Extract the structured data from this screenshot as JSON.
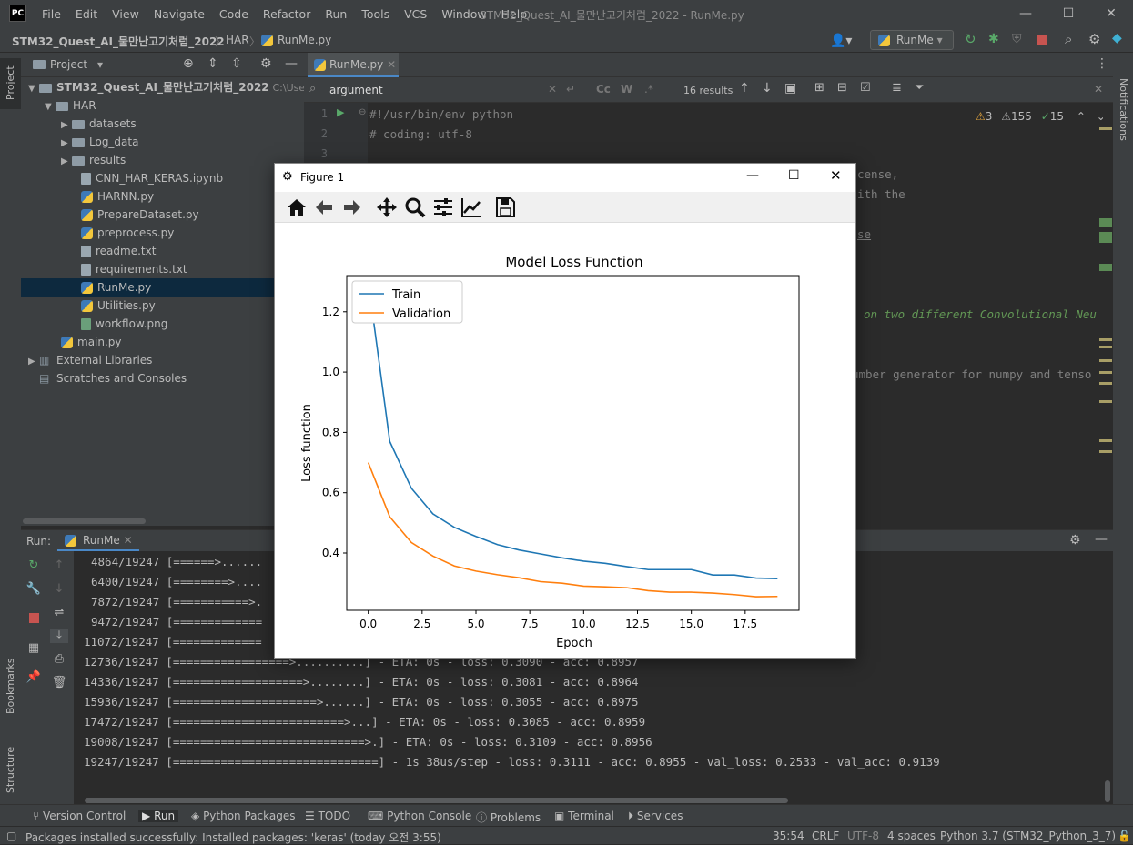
{
  "window": {
    "logo": "PC",
    "title": "STM32_Quest_AI_물만난고기처럼_2022 - RunMe.py",
    "menu": [
      "File",
      "Edit",
      "View",
      "Navigate",
      "Code",
      "Refactor",
      "Run",
      "Tools",
      "VCS",
      "Window",
      "Help"
    ],
    "controls": [
      "minimize-icon",
      "maximize-icon",
      "close-icon"
    ]
  },
  "breadcrumb": [
    "STM32_Quest_AI_물만난고기처럼_2022",
    "HAR",
    "RunMe.py"
  ],
  "run_config": "RunMe",
  "project": {
    "header": "Project",
    "root": "STM32_Quest_AI_물만난고기처럼_2022",
    "root_path": "C:\\User",
    "items": [
      {
        "label": "HAR",
        "kind": "folder",
        "level": 1,
        "expanded": true
      },
      {
        "label": "datasets",
        "kind": "folder",
        "level": 2
      },
      {
        "label": "Log_data",
        "kind": "folder",
        "level": 2
      },
      {
        "label": "results",
        "kind": "folder",
        "level": 2
      },
      {
        "label": "CNN_HAR_KERAS.ipynb",
        "kind": "file",
        "level": 2
      },
      {
        "label": "HARNN.py",
        "kind": "py",
        "level": 2
      },
      {
        "label": "PrepareDataset.py",
        "kind": "py",
        "level": 2
      },
      {
        "label": "preprocess.py",
        "kind": "py",
        "level": 2
      },
      {
        "label": "readme.txt",
        "kind": "file",
        "level": 2
      },
      {
        "label": "requirements.txt",
        "kind": "file",
        "level": 2
      },
      {
        "label": "RunMe.py",
        "kind": "py",
        "level": 2,
        "selected": true
      },
      {
        "label": "Utilities.py",
        "kind": "py",
        "level": 2
      },
      {
        "label": "workflow.png",
        "kind": "file",
        "level": 2
      },
      {
        "label": "main.py",
        "kind": "py",
        "level": 1
      },
      {
        "label": "External Libraries",
        "kind": "lib",
        "level": 0
      },
      {
        "label": "Scratches and Consoles",
        "kind": "scratch",
        "level": 0
      }
    ]
  },
  "side_tabs": {
    "left_top": "Project",
    "left_mid": "Bookmarks",
    "left_bottom": "Structure",
    "right": "Notifications"
  },
  "editor": {
    "tab": "RunMe.py",
    "search": {
      "value": "argument",
      "results": "16 results"
    },
    "inspections": {
      "warnings": "3",
      "weak": "155",
      "ok": "15"
    },
    "line_numbers": [
      "1",
      "2",
      "3"
    ],
    "lines": [
      "#!/usr/bin/env python",
      "# coding: utf-8",
      ""
    ],
    "fragments": [
      "cense,",
      "ith the",
      "se",
      "on two different Convolutional Neu",
      "umber generator for numpy and tenso"
    ]
  },
  "run": {
    "label": "Run:",
    "tab": "RunMe",
    "console": [
      "4864/19247 [======>......",
      "6400/19247 [========>....",
      "7872/19247 [===========>.",
      "9472/19247 [=============",
      "11072/19247 [=============",
      "12736/19247 [=================>..........] - ETA: 0s - loss: 0.3090 - acc: 0.8957",
      "14336/19247 [===================>........] - ETA: 0s - loss: 0.3081 - acc: 0.8964",
      "15936/19247 [=====================>......] - ETA: 0s - loss: 0.3055 - acc: 0.8975",
      "17472/19247 [=========================>...] - ETA: 0s - loss: 0.3085 - acc: 0.8959",
      "19008/19247 [============================>.] - ETA: 0s - loss: 0.3109 - acc: 0.8956",
      "19247/19247 [==============================] - 1s 38us/step - loss: 0.3111 - acc: 0.8955 - val_loss: 0.2533 - val_acc: 0.9139"
    ]
  },
  "bottom_tabs": [
    "Version Control",
    "Run",
    "Python Packages",
    "TODO",
    "Python Console",
    "Problems",
    "Terminal",
    "Services"
  ],
  "status": {
    "message": "Packages installed successfully: Installed packages: 'keras' (today 오전 3:55)",
    "position": "35:54",
    "line_sep": "CRLF",
    "encoding": "UTF-8",
    "indent": "4 spaces",
    "interpreter": "Python 3.7 (STM32_Python_3_7)"
  },
  "figure": {
    "window_title": "Figure 1",
    "toolbar": [
      "home-icon",
      "back-icon",
      "forward-icon",
      "pan-icon",
      "zoom-icon",
      "configure-subplots-icon",
      "edit-axis-icon",
      "save-icon"
    ]
  },
  "chart_data": {
    "type": "line",
    "title": "Model Loss Function",
    "xlabel": "Epoch",
    "ylabel": "Loss function",
    "xlim": [
      -1,
      20
    ],
    "ylim": [
      0.21,
      1.32
    ],
    "xticks": [
      "0.0",
      "2.5",
      "5.0",
      "7.5",
      "10.0",
      "12.5",
      "15.0",
      "17.5"
    ],
    "yticks": [
      "0.4",
      "0.6",
      "0.8",
      "1.0",
      "1.2"
    ],
    "legend_position": "top-left",
    "x": [
      0,
      1,
      2,
      3,
      4,
      5,
      6,
      7,
      8,
      9,
      10,
      11,
      12,
      13,
      14,
      15,
      16,
      17,
      18,
      19
    ],
    "series": [
      {
        "name": "Train",
        "color": "#1f77b4",
        "values": [
          1.3,
          0.77,
          0.615,
          0.53,
          0.485,
          0.455,
          0.428,
          0.41,
          0.397,
          0.384,
          0.373,
          0.366,
          0.355,
          0.345,
          0.345,
          0.345,
          0.327,
          0.327,
          0.317,
          0.315
        ]
      },
      {
        "name": "Validation",
        "color": "#ff7f0e",
        "values": [
          0.7,
          0.52,
          0.435,
          0.39,
          0.357,
          0.34,
          0.328,
          0.318,
          0.305,
          0.3,
          0.29,
          0.288,
          0.285,
          0.275,
          0.27,
          0.27,
          0.267,
          0.262,
          0.255,
          0.256
        ]
      }
    ]
  }
}
